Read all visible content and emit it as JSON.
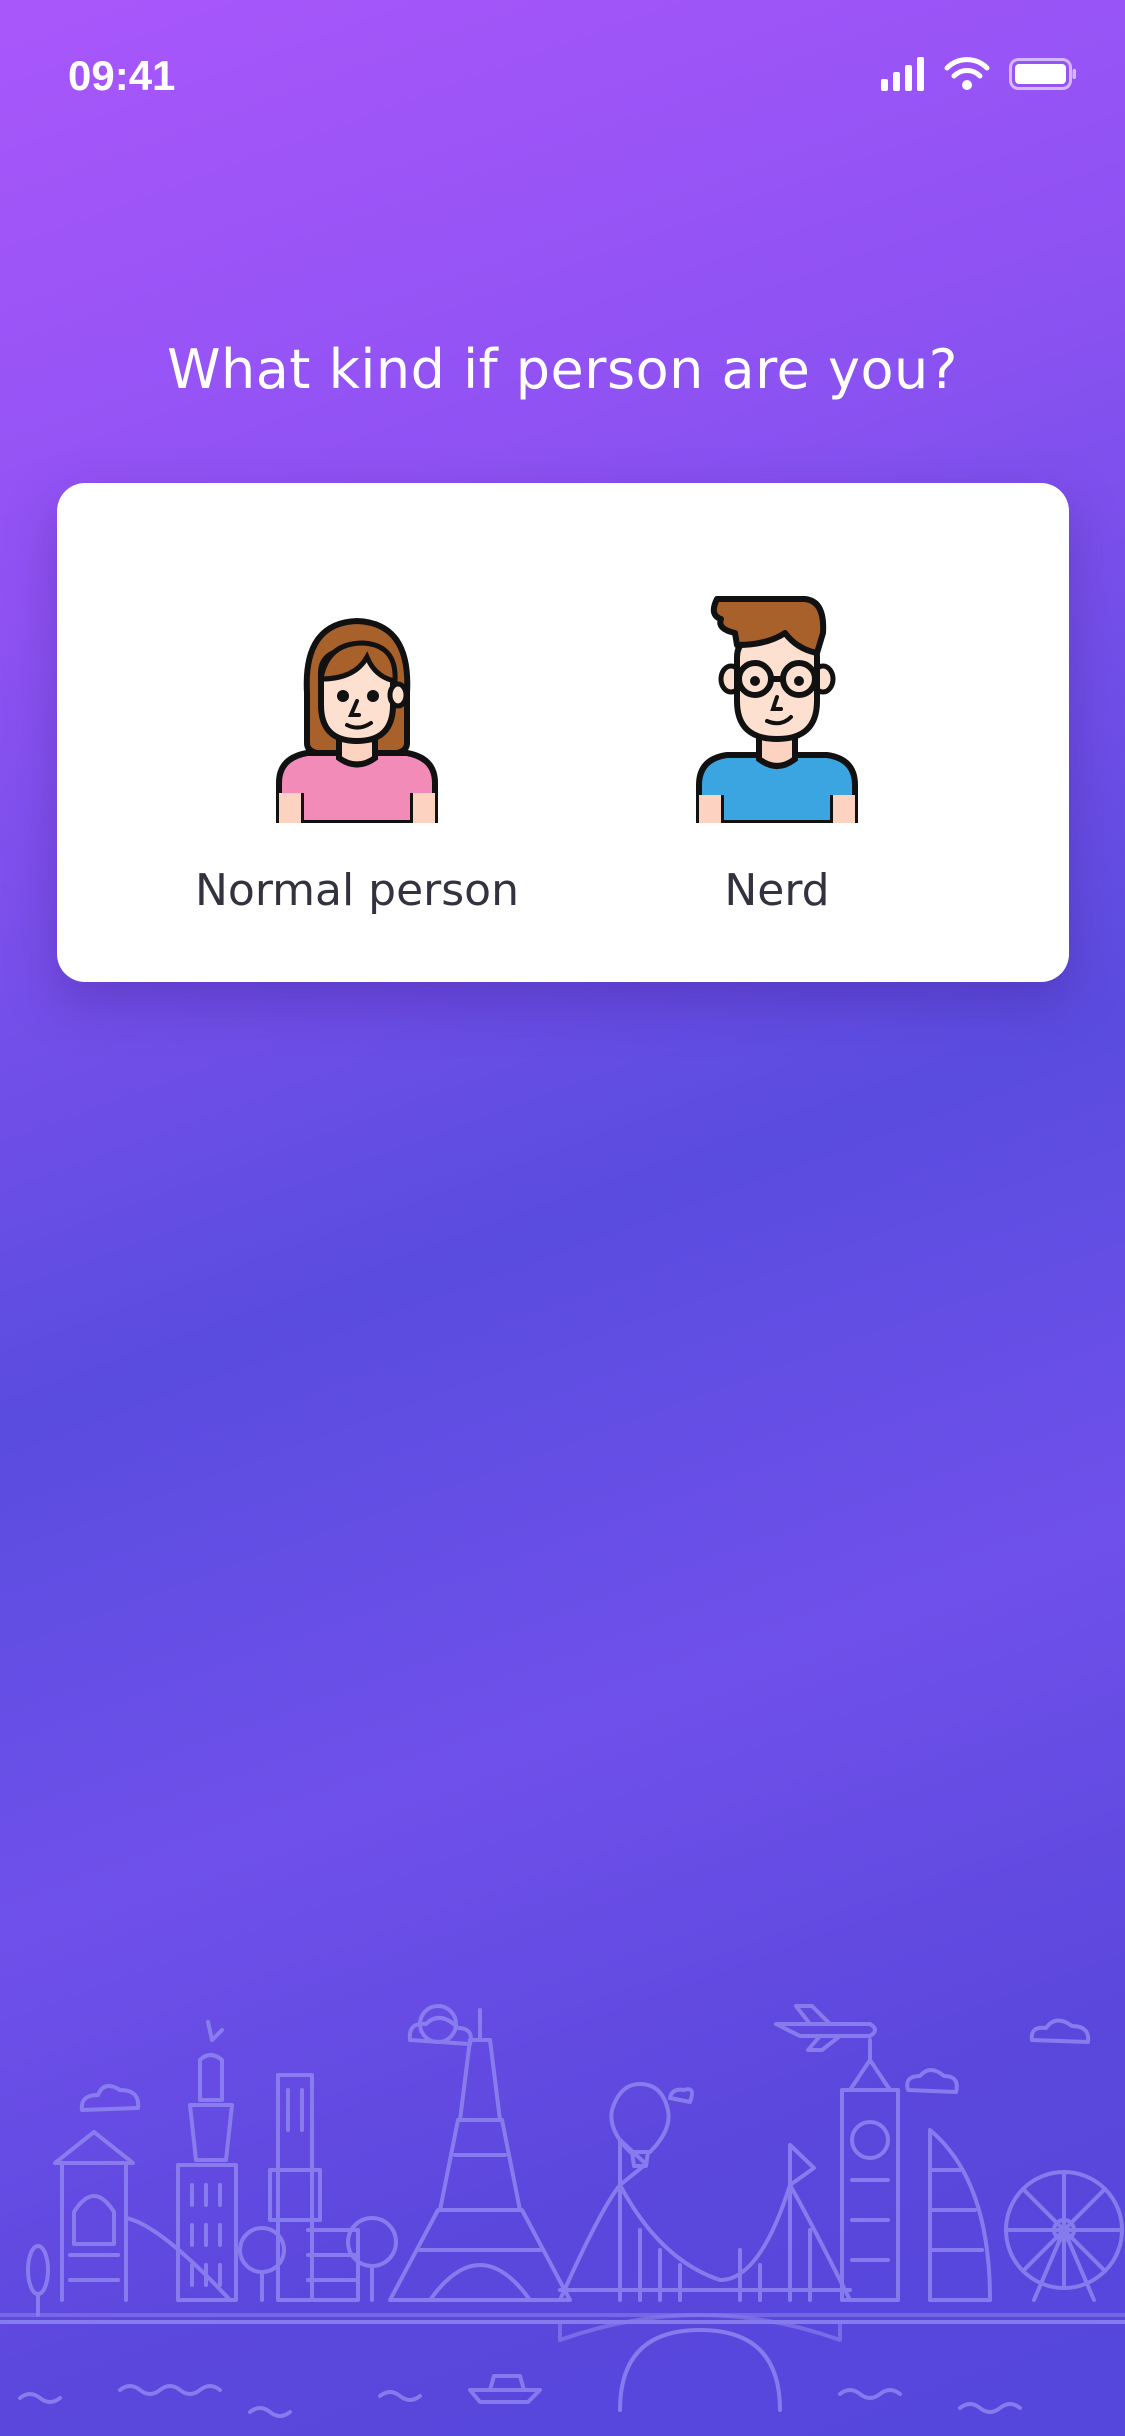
{
  "status_bar": {
    "time": "09:41",
    "icons": [
      "signal-icon",
      "wifi-icon",
      "battery-icon"
    ]
  },
  "question": "What kind if person are you?",
  "options": [
    {
      "label": "Normal person",
      "icon": "woman-avatar-icon"
    },
    {
      "label": "Nerd",
      "icon": "nerd-avatar-icon"
    }
  ],
  "colors": {
    "gradient_top": "#a957fb",
    "gradient_bottom": "#5547dc",
    "card": "#ffffff",
    "label_text": "#333340",
    "skyline_lines": "#8f85f0"
  }
}
